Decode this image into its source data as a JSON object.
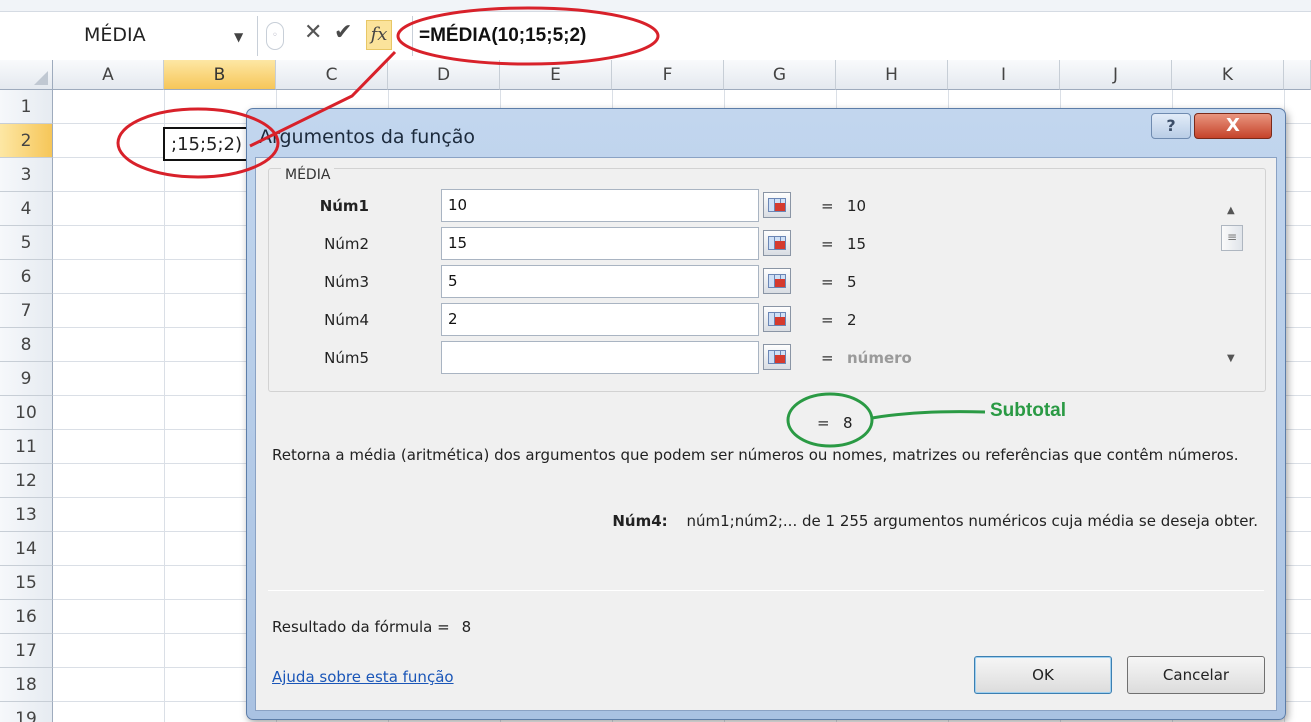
{
  "formula_bar": {
    "name_box": "MÉDIA",
    "formula": "=MÉDIA(10;15;5;2)",
    "icons": [
      "dropdown-arrow",
      "cancel-x",
      "enter-check",
      "insert-function-fx"
    ]
  },
  "sheet": {
    "columns": [
      "A",
      "B",
      "C",
      "D",
      "E",
      "F",
      "G",
      "H",
      "I",
      "J",
      "K"
    ],
    "rows": [
      "1",
      "2",
      "3",
      "4",
      "5",
      "6",
      "7",
      "8",
      "9",
      "10",
      "11",
      "12",
      "13",
      "14",
      "15",
      "16",
      "17",
      "18",
      "19"
    ],
    "selected_column": "B",
    "selected_row": "2",
    "active_cell_text": ";15;5;2)"
  },
  "dialog": {
    "title": "Argumentos da função",
    "help_button": "?",
    "close_button": "X",
    "function_name": "MÉDIA",
    "args": [
      {
        "label": "Núm1",
        "value": "10",
        "eq": "=",
        "result": "10",
        "bold": true
      },
      {
        "label": "Núm2",
        "value": "15",
        "eq": "=",
        "result": "15"
      },
      {
        "label": "Núm3",
        "value": "5",
        "eq": "=",
        "result": "5"
      },
      {
        "label": "Núm4",
        "value": "2",
        "eq": "=",
        "result": "2"
      },
      {
        "label": "Núm5",
        "value": "",
        "eq": "=",
        "result": "número"
      }
    ],
    "subtotal_eq": "=",
    "subtotal_value": "8",
    "description": "Retorna a média (aritmética) dos argumentos que podem ser números ou nomes, matrizes ou referências que contêm números.",
    "arg_help_name": "Núm4:",
    "arg_help_text": "núm1;núm2;... de 1 255 argumentos numéricos cuja média se deseja obter.",
    "result_label": "Resultado da fórmula =",
    "result_value": "8",
    "help_link": "Ajuda sobre esta função",
    "ok": "OK",
    "cancel": "Cancelar"
  },
  "annotations": {
    "subtotal_label": "Subtotal",
    "red_color": "#d8212a",
    "green_color": "#2a9a44"
  }
}
